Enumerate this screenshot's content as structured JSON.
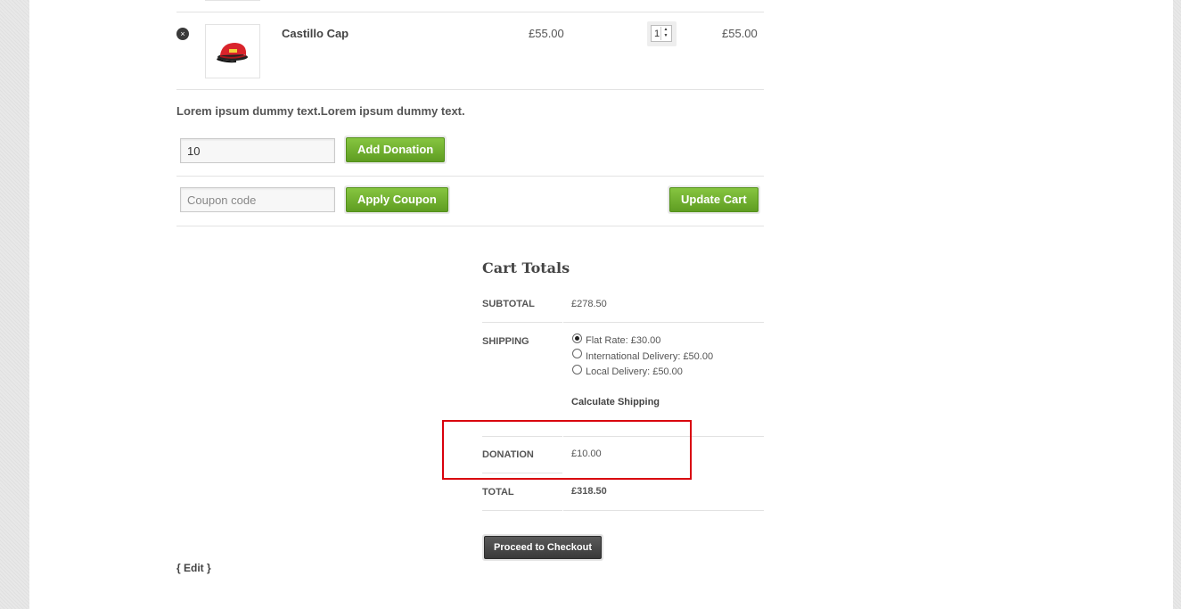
{
  "cart_item": {
    "remove_icon": "×",
    "name": "Castillo Cap",
    "price": "£55.00",
    "quantity": "1",
    "subtotal": "£55.00",
    "image": "red-cap-image"
  },
  "donation": {
    "message": "Lorem ipsum dummy text.Lorem ipsum dummy text.",
    "amount_value": "10",
    "add_button": "Add Donation"
  },
  "coupon": {
    "placeholder": "Coupon code",
    "apply_button": "Apply Coupon",
    "update_button": "Update Cart"
  },
  "cart_totals": {
    "title": "Cart Totals",
    "subtotal_label": "SUBTOTAL",
    "subtotal_value": "£278.50",
    "shipping_label": "SHIPPING",
    "shipping_options": [
      {
        "label": "Flat Rate: £30.00",
        "selected": true
      },
      {
        "label": "International Delivery: £50.00",
        "selected": false
      },
      {
        "label": "Local Delivery: £50.00",
        "selected": false
      }
    ],
    "calculate_shipping": "Calculate Shipping",
    "donation_label": "DONATION",
    "donation_value": "£10.00",
    "total_label": "TOTAL",
    "total_value": "£318.50",
    "checkout_button": "Proceed to Checkout"
  },
  "edit_link": "{ Edit }",
  "colors": {
    "green_button": "#6fb02f",
    "highlight_box": "#d9000d",
    "checkout_button": "#444444"
  }
}
